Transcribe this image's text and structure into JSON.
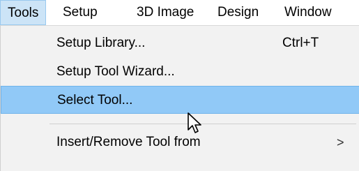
{
  "menubar": {
    "items": [
      {
        "label": "Tools",
        "active": true
      },
      {
        "label": "Setup"
      },
      {
        "label": "3D Image"
      },
      {
        "label": "Design"
      },
      {
        "label": "Window"
      }
    ]
  },
  "tools_menu": {
    "items": [
      {
        "label": "Setup Library...",
        "shortcut": "Ctrl+T"
      },
      {
        "label": "Setup Tool Wizard..."
      },
      {
        "label": "Select Tool...",
        "highlighted": true
      },
      {
        "label": "Insert/Remove Tool from",
        "submenu_arrow": ">"
      }
    ]
  },
  "colors": {
    "menubar_active_bg": "#cce4f7",
    "menu_bg": "#f2f2f2",
    "highlight_bg": "#91c9f7"
  },
  "icons": {
    "cursor": "mouse-pointer-icon",
    "submenu": "chevron-right-icon"
  }
}
